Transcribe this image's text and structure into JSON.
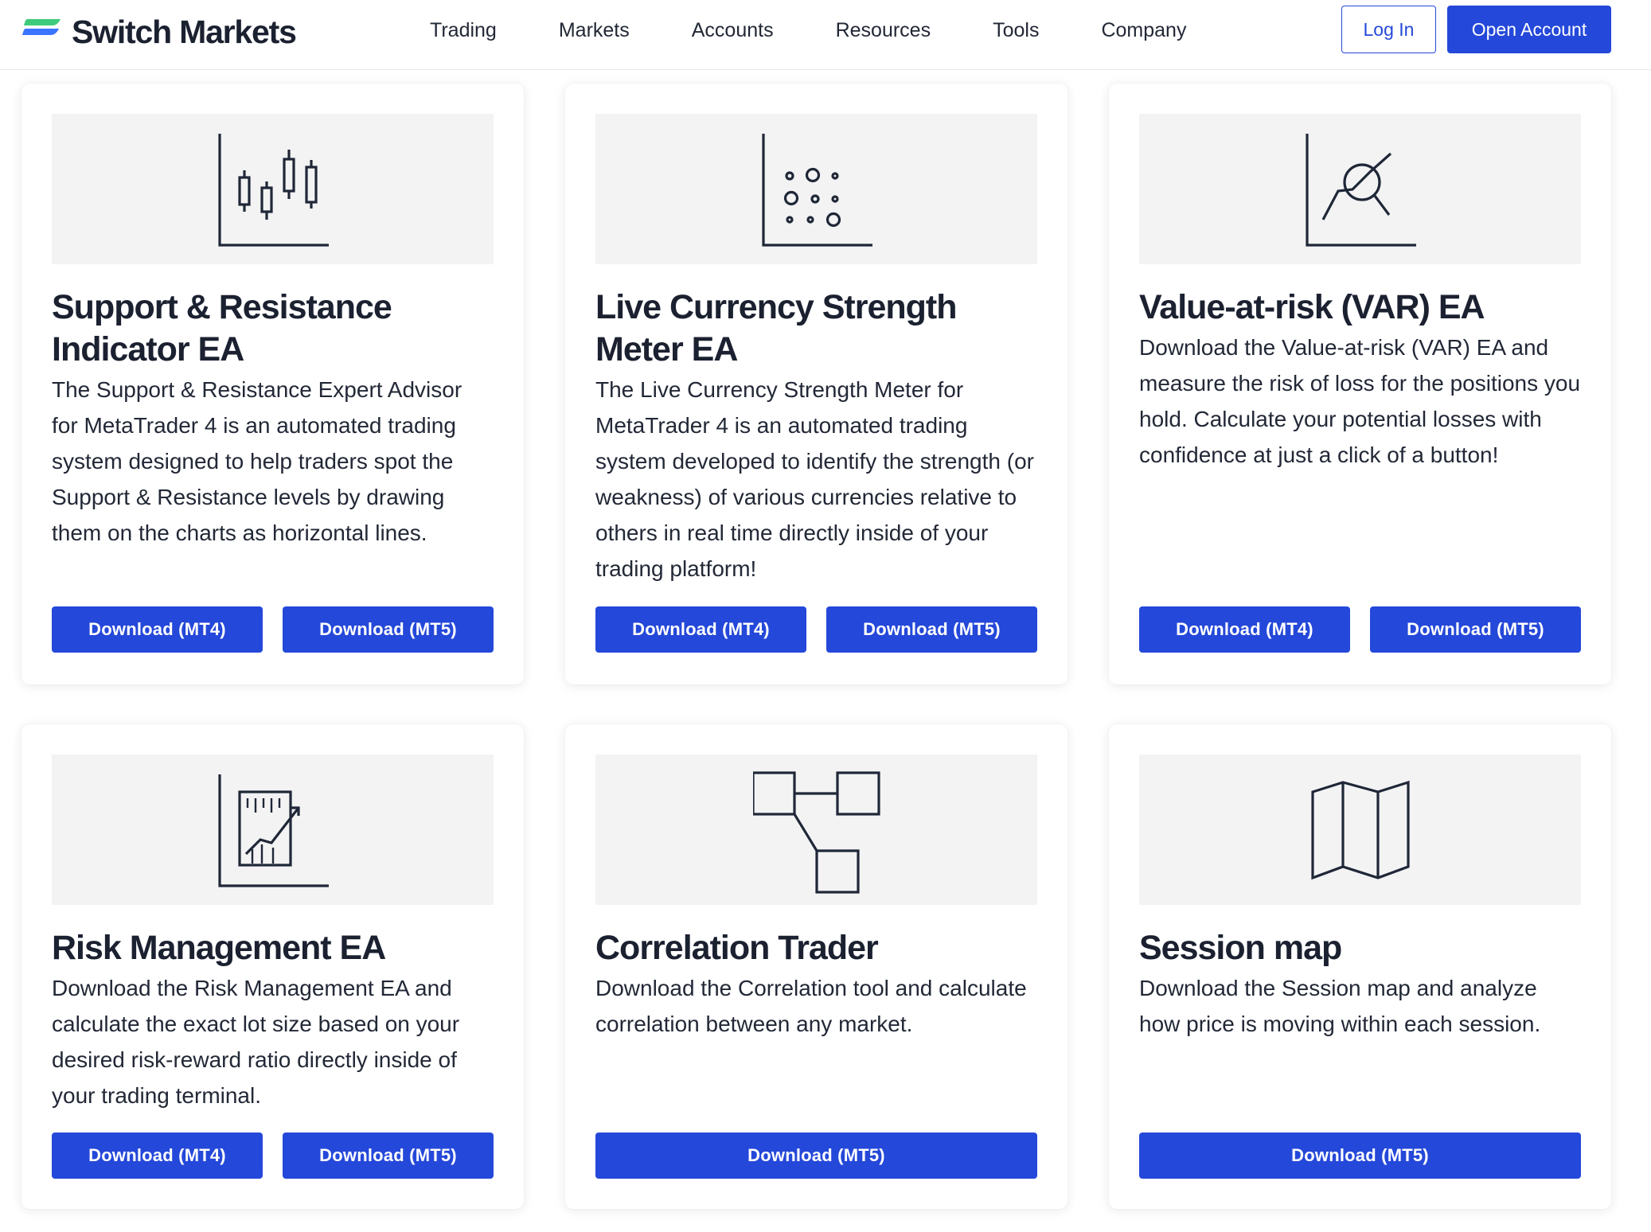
{
  "brand": {
    "name": "Switch Markets",
    "primary": "#2448d9",
    "logo_green": "#3ecb7a",
    "logo_blue": "#2f6bff"
  },
  "nav": {
    "items": [
      "Trading",
      "Markets",
      "Accounts",
      "Resources",
      "Tools",
      "Company"
    ],
    "login_label": "Log In",
    "open_account_label": "Open Account"
  },
  "cards": [
    {
      "icon": "candlestick-chart-icon",
      "title": "Support & Resistance Indicator EA",
      "description": "The Support & Resistance Expert Advisor for MetaTrader 4 is an automated trading system designed to help traders spot the Support & Resistance levels by drawing them on the charts as horizontal lines.",
      "buttons": [
        "Download (MT4)",
        "Download (MT5)"
      ]
    },
    {
      "icon": "scatter-plot-icon",
      "title": "Live Currency Strength Meter EA",
      "description": "The Live Currency Strength Meter for MetaTrader 4 is an automated trading system developed to identify the strength (or weakness) of various currencies relative to others in real time directly inside of your trading platform!",
      "buttons": [
        "Download (MT4)",
        "Download (MT5)"
      ]
    },
    {
      "icon": "chart-magnifier-icon",
      "title": "Value-at-risk (VAR) EA",
      "description": "Download the Value-at-risk (VAR) EA and measure the risk of loss for the positions you hold. Calculate your potential losses with confidence at just a click of a button!",
      "buttons": [
        "Download (MT4)",
        "Download (MT5)"
      ]
    },
    {
      "icon": "growth-report-icon",
      "title": "Risk Management EA",
      "description": "Download the Risk Management EA and calculate the exact lot size based on your desired risk-reward ratio directly inside of your trading terminal.",
      "buttons": [
        "Download (MT4)",
        "Download (MT5)"
      ]
    },
    {
      "icon": "connected-boxes-icon",
      "title": "Correlation Trader",
      "description": "Download the Correlation tool and calculate correlation between any market.",
      "buttons": [
        "Download (MT5)"
      ]
    },
    {
      "icon": "folded-map-icon",
      "title": "Session map",
      "description": "Download the Session map and analyze how price is moving within each session.",
      "buttons": [
        "Download (MT5)"
      ]
    }
  ]
}
